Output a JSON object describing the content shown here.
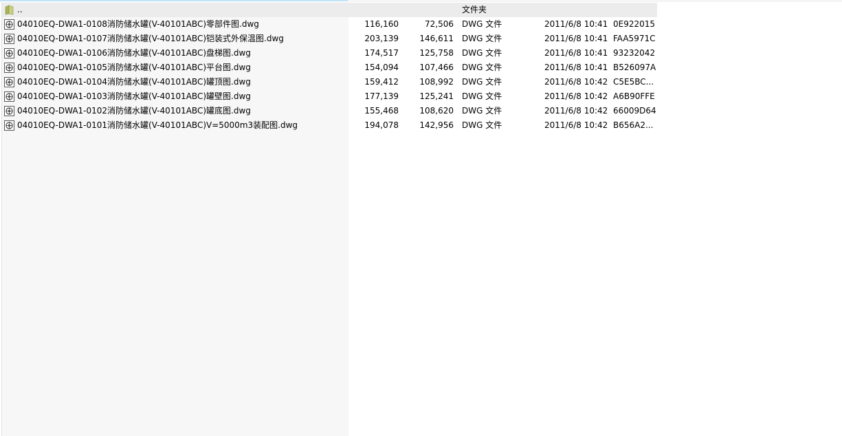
{
  "parent_row": {
    "name": "..",
    "type": "文件夹",
    "icon": "folder-icon"
  },
  "files": [
    {
      "name": "04010EQ-DWA1-0108消防储水罐(V-40101ABC)零部件图.dwg",
      "size": "116,160",
      "packed": "72,506",
      "type": "DWG 文件",
      "modified": "2011/6/8 10:41",
      "crc": "0E922015",
      "icon": "dwg-file-icon"
    },
    {
      "name": "04010EQ-DWA1-0107消防储水罐(V-40101ABC)铠装式外保温图.dwg",
      "size": "203,139",
      "packed": "146,611",
      "type": "DWG 文件",
      "modified": "2011/6/8 10:41",
      "crc": "FAA5971C",
      "icon": "dwg-file-icon"
    },
    {
      "name": "04010EQ-DWA1-0106消防储水罐(V-40101ABC)盘梯图.dwg",
      "size": "174,517",
      "packed": "125,758",
      "type": "DWG 文件",
      "modified": "2011/6/8 10:41",
      "crc": "93232042",
      "icon": "dwg-file-icon"
    },
    {
      "name": "04010EQ-DWA1-0105消防储水罐(V-40101ABC)平台图.dwg",
      "size": "154,094",
      "packed": "107,466",
      "type": "DWG 文件",
      "modified": "2011/6/8 10:41",
      "crc": "B526097A",
      "icon": "dwg-file-icon"
    },
    {
      "name": "04010EQ-DWA1-0104消防储水罐(V-40101ABC)罐顶图.dwg",
      "size": "159,412",
      "packed": "108,992",
      "type": "DWG 文件",
      "modified": "2011/6/8 10:42",
      "crc": "C5E5BC...",
      "icon": "dwg-file-icon"
    },
    {
      "name": "04010EQ-DWA1-0103消防储水罐(V-40101ABC)罐壁图.dwg",
      "size": "177,139",
      "packed": "125,241",
      "type": "DWG 文件",
      "modified": "2011/6/8 10:42",
      "crc": "A6B90FFE",
      "icon": "dwg-file-icon"
    },
    {
      "name": "04010EQ-DWA1-0102消防储水罐(V-40101ABC)罐底图.dwg",
      "size": "155,468",
      "packed": "108,620",
      "type": "DWG 文件",
      "modified": "2011/6/8 10:42",
      "crc": "66009D64",
      "icon": "dwg-file-icon"
    },
    {
      "name": "04010EQ-DWA1-0101消防储水罐(V-40101ABC)V=5000m3装配图.dwg",
      "size": "194,078",
      "packed": "142,956",
      "type": "DWG 文件",
      "modified": "2011/6/8 10:42",
      "crc": "B656A2...",
      "icon": "dwg-file-icon"
    }
  ],
  "colors": {
    "name_column_bg": "#f7f7f7",
    "parent_row_bg": "#ececec",
    "top_accent": "#bfe3f5",
    "folder_icon": "#b5bd68",
    "text": "#000000"
  }
}
